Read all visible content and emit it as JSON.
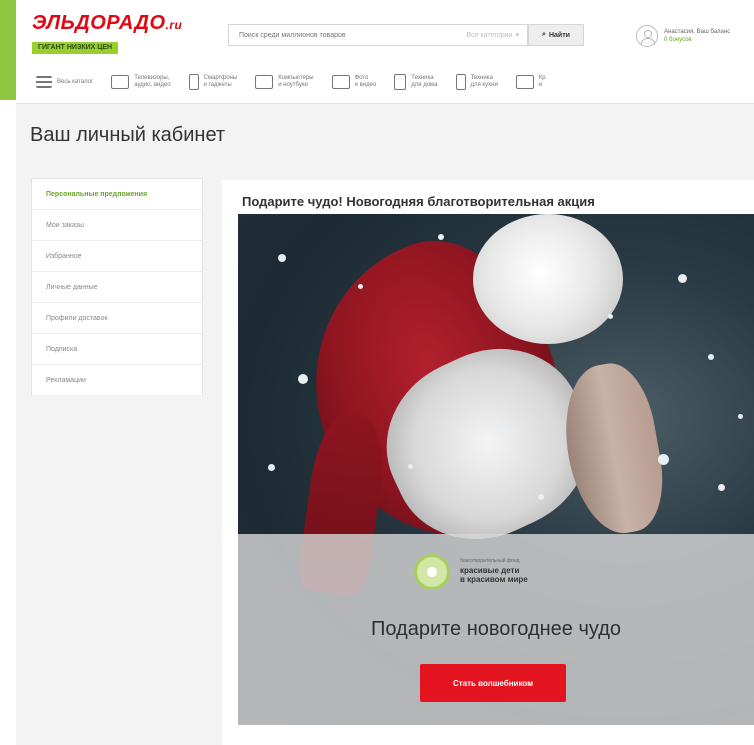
{
  "header": {
    "logo": {
      "name": "ЭЛЬДОРАДО",
      "suffix": ".ru",
      "tagline": "ГИГАНТ НИЗКИХ ЦЕН"
    },
    "search": {
      "placeholder": "Поиск среди миллионов товаров",
      "category": "Все категории",
      "button_label": "Найти"
    },
    "user": {
      "line1": "Анастасия, Ваш баланс",
      "line2": "0 бонусов"
    }
  },
  "nav": {
    "items": [
      {
        "label": "Весь каталог",
        "icon": "menu-icon"
      },
      {
        "label": "Телевизоры,\nаудио, видео",
        "icon": "tv-icon"
      },
      {
        "label": "Смартфоны\nи гаджеты",
        "icon": "smartphone-icon"
      },
      {
        "label": "Компьютеры\nи ноутбуки",
        "icon": "laptop-icon"
      },
      {
        "label": "Фото\nи видео",
        "icon": "camera-icon"
      },
      {
        "label": "Техника\nдля дома",
        "icon": "washer-icon"
      },
      {
        "label": "Техника\nдля кухни",
        "icon": "fridge-icon"
      },
      {
        "label": "Кр\nи",
        "icon": "hairdryer-icon"
      }
    ]
  },
  "page": {
    "title": "Ваш личный кабинет"
  },
  "sidebar": {
    "items": [
      {
        "label": "Персональные предложения",
        "active": true
      },
      {
        "label": "Мои заказы"
      },
      {
        "label": "Избранное"
      },
      {
        "label": "Личные данные"
      },
      {
        "label": "Профили доставок"
      },
      {
        "label": "Подписка"
      },
      {
        "label": "Рекламации"
      }
    ]
  },
  "promo": {
    "title": "Подарите чудо! Новогодняя благотворительная акция",
    "fund_small": "благотворительный фонд",
    "fund_name_line1": "красивые дети",
    "fund_name_line2": "в красивом мире",
    "overlay_title": "Подарите новогоднее чудо",
    "cta_label": "Стать волшебником"
  },
  "colors": {
    "accent_green": "#8ec641",
    "brand_red": "#e30613",
    "cta_red": "#e3141f"
  }
}
